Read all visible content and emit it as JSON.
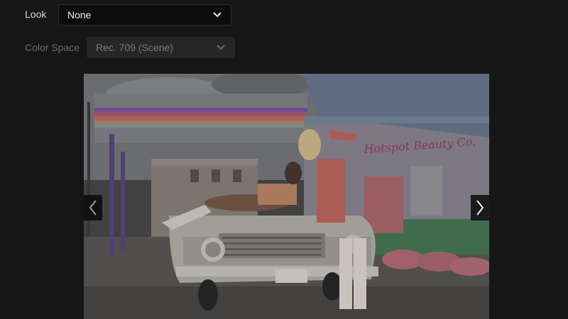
{
  "look": {
    "label": "Look",
    "value": "None"
  },
  "color_space": {
    "label": "Color Space",
    "value": "Rec. 709 (Scene)",
    "enabled": false
  },
  "preview": {
    "sign_text": "Hotspot Beauty Co."
  },
  "icons": {
    "look_dropdown": "chevron-down-icon",
    "color_space_dropdown": "chevron-down-icon",
    "prev": "chevron-left-icon",
    "next": "chevron-right-icon"
  },
  "colors": {
    "background": "#161616",
    "text": "#d8d8d8",
    "disabled_text": "#6a6a6a"
  }
}
